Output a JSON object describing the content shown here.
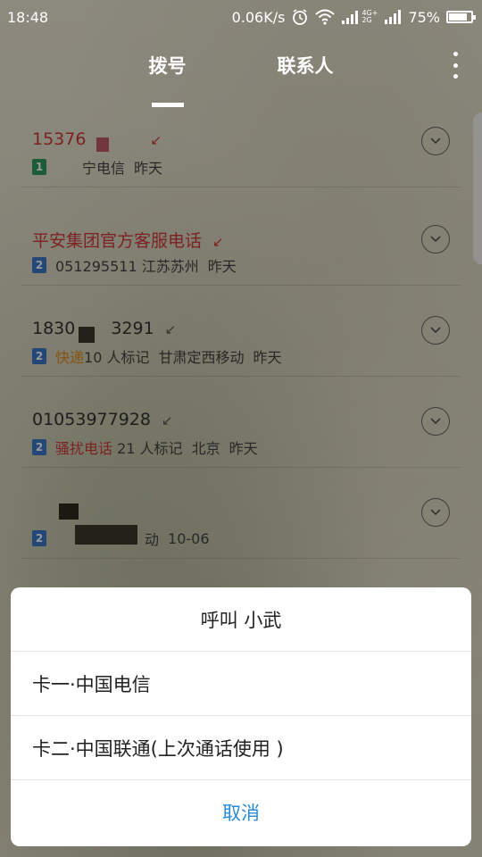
{
  "status_bar": {
    "time": "18:48",
    "net_speed": "0.06K/s",
    "battery_text": "75%",
    "battery_level": 0.75,
    "network_label": "4G+",
    "network_label2": "2G"
  },
  "tabs": [
    {
      "label": "拨号",
      "active": true
    },
    {
      "label": "联系人",
      "active": false
    }
  ],
  "calls": [
    {
      "name": "1537",
      "name_suffix": "6",
      "red": true,
      "sim": "1",
      "sim_color": "#2e9b5e",
      "tag": "",
      "location": "宁电信",
      "date": "昨天"
    },
    {
      "name": "平安集团官方客服电话",
      "red": true,
      "sim": "2",
      "sim_color": "#3b78c7",
      "tag": "",
      "location": "051295511 江苏苏州",
      "date": "昨天"
    },
    {
      "name": "1830",
      "name_suffix": "3291",
      "red": false,
      "sim": "2",
      "sim_color": "#3b78c7",
      "tag": "快递",
      "tag_after": "10 人标记",
      "location": "甘肃定西移动",
      "date": "昨天"
    },
    {
      "name": "01053977928",
      "red": false,
      "sim": "2",
      "sim_color": "#3b78c7",
      "tag": "骚扰电话",
      "tag_after": "21 人标记",
      "location": "北京",
      "date": "昨天"
    },
    {
      "name": "",
      "red": false,
      "sim": "2",
      "sim_color": "#3b78c7",
      "tag": "",
      "location": "动",
      "date": "10-06"
    }
  ],
  "dialog": {
    "title": "呼叫 小武",
    "option1": "卡一·中国电信",
    "option2": "卡二·中国联通(上次通话使用 )",
    "cancel": "取消"
  },
  "colors": {
    "accent": "#2a8bd8",
    "missed_red": "#d13a3a"
  }
}
